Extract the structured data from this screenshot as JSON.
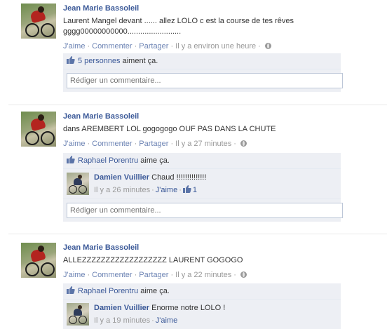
{
  "posts": [
    {
      "author": "Jean Marie Bassoleil",
      "message": "Laurent Mangel devant ...... allez LOLO c est la course de tes rêves\ngggg00000000000.........................",
      "like_label": "J'aime",
      "comment_label": "Commenter",
      "share_label": "Partager",
      "separator": "·",
      "time": "Il y a environ une heure",
      "likes_count_link": "5 personnes",
      "likes_suffix": " aiment ça.",
      "compose_placeholder": "Rédiger un commentaire..."
    },
    {
      "author": "Jean Marie Bassoleil",
      "message": "dans AREMBERT LOL gogogogo OUF PAS DANS LA CHUTE",
      "like_label": "J'aime",
      "comment_label": "Commenter",
      "share_label": "Partager",
      "separator": "·",
      "time": "Il y a 27 minutes",
      "likes_name_link": "Raphael Porentru",
      "likes_suffix": " aime ça.",
      "comment": {
        "author": "Damien Vuillier",
        "text": " Chaud !!!!!!!!!!!!!!",
        "time": "Il y a 26 minutes",
        "like_label": "J'aime",
        "like_count": "1"
      },
      "compose_placeholder": "Rédiger un commentaire..."
    },
    {
      "author": "Jean Marie Bassoleil",
      "message": "ALLEZZZZZZZZZZZZZZZZZZ LAURENT GOGOGO",
      "like_label": "J'aime",
      "comment_label": "Commenter",
      "share_label": "Partager",
      "separator": "·",
      "time": "Il y a 22 minutes",
      "likes_name_link": "Raphael Porentru",
      "likes_suffix": " aime ça.",
      "comment": {
        "author": "Damien Vuillier",
        "text": " Enorme notre LOLO !",
        "time": "Il y a 19 minutes",
        "like_label": "J'aime"
      }
    }
  ],
  "colors": {
    "link": "#3b5998",
    "action_link": "#6d84b4",
    "meta_gray": "#999999",
    "ufi_bg": "#edeff4"
  }
}
